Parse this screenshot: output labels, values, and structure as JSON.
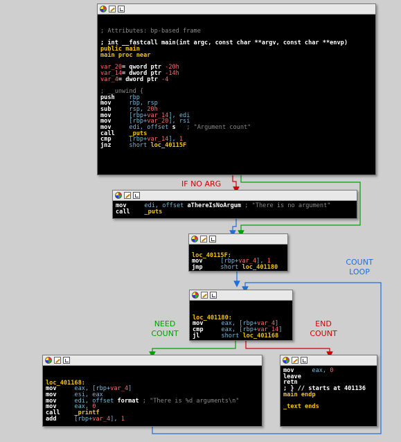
{
  "nodes": {
    "main": [
      {
        "segs": [
          {
            "t": "; Attributes: bp-based frame",
            "c": "c"
          }
        ]
      },
      {
        "segs": []
      },
      {
        "segs": [
          {
            "t": "; int __fastcall main(int argc, const char **argv, const char **envp)",
            "c": "k"
          }
        ]
      },
      {
        "segs": [
          {
            "t": "public main",
            "c": "lbl"
          }
        ]
      },
      {
        "segs": [
          {
            "t": "main proc near",
            "c": "lbl"
          }
        ]
      },
      {
        "segs": []
      },
      {
        "segs": [
          {
            "t": "var_20",
            "c": "num"
          },
          {
            "t": "= qword ptr ",
            "c": "k"
          },
          {
            "t": "-20h",
            "c": "num"
          }
        ]
      },
      {
        "segs": [
          {
            "t": "var_14",
            "c": "num"
          },
          {
            "t": "= dword ptr ",
            "c": "k"
          },
          {
            "t": "-14h",
            "c": "num"
          }
        ]
      },
      {
        "segs": [
          {
            "t": "var_4",
            "c": "num"
          },
          {
            "t": "= dword ptr ",
            "c": "k"
          },
          {
            "t": "-4",
            "c": "num"
          }
        ]
      },
      {
        "segs": []
      },
      {
        "segs": [
          {
            "t": "; __unwind {",
            "c": "c"
          }
        ]
      },
      {
        "segs": [
          {
            "t": "push    ",
            "c": "k"
          },
          {
            "t": "rbp",
            "c": "o"
          }
        ]
      },
      {
        "segs": [
          {
            "t": "mov     ",
            "c": "k"
          },
          {
            "t": "rbp, rsp",
            "c": "o"
          }
        ]
      },
      {
        "segs": [
          {
            "t": "sub     ",
            "c": "k"
          },
          {
            "t": "rsp, ",
            "c": "o"
          },
          {
            "t": "20h",
            "c": "num"
          }
        ]
      },
      {
        "segs": [
          {
            "t": "mov     ",
            "c": "k"
          },
          {
            "t": "[rbp+",
            "c": "o"
          },
          {
            "t": "var_14",
            "c": "num"
          },
          {
            "t": "], edi",
            "c": "o"
          }
        ]
      },
      {
        "segs": [
          {
            "t": "mov     ",
            "c": "k"
          },
          {
            "t": "[rbp+",
            "c": "o"
          },
          {
            "t": "var_20",
            "c": "num"
          },
          {
            "t": "], rsi",
            "c": "o"
          }
        ]
      },
      {
        "segs": [
          {
            "t": "mov     ",
            "c": "k"
          },
          {
            "t": "edi, offset ",
            "c": "o"
          },
          {
            "t": "s",
            "c": "k"
          },
          {
            "t": "   ; \"Argument count\"",
            "c": "c"
          }
        ]
      },
      {
        "segs": [
          {
            "t": "call    ",
            "c": "k"
          },
          {
            "t": "_puts",
            "c": "lbl"
          }
        ]
      },
      {
        "segs": [
          {
            "t": "cmp     ",
            "c": "k"
          },
          {
            "t": "[rbp+",
            "c": "o"
          },
          {
            "t": "var_14",
            "c": "num"
          },
          {
            "t": "], ",
            "c": "o"
          },
          {
            "t": "1",
            "c": "num"
          }
        ]
      },
      {
        "segs": [
          {
            "t": "jnz     ",
            "c": "k"
          },
          {
            "t": "short ",
            "c": "o"
          },
          {
            "t": "loc_40115F",
            "c": "lbl"
          }
        ]
      }
    ],
    "noarg": [
      {
        "segs": [
          {
            "t": "mov     ",
            "c": "k"
          },
          {
            "t": "edi, offset ",
            "c": "o"
          },
          {
            "t": "aThereIsNoArgum",
            "c": "k"
          },
          {
            "t": " ; \"There is no argument\"",
            "c": "c"
          }
        ]
      },
      {
        "segs": [
          {
            "t": "call    ",
            "c": "k"
          },
          {
            "t": "_puts",
            "c": "lbl"
          }
        ]
      }
    ],
    "loc115f": [
      {
        "segs": []
      },
      {
        "segs": [
          {
            "t": "loc_40115F:",
            "c": "lbl"
          }
        ]
      },
      {
        "segs": [
          {
            "t": "mov     ",
            "c": "k"
          },
          {
            "t": "[rbp+",
            "c": "o"
          },
          {
            "t": "var_4",
            "c": "num"
          },
          {
            "t": "], ",
            "c": "o"
          },
          {
            "t": "1",
            "c": "num"
          }
        ]
      },
      {
        "segs": [
          {
            "t": "jmp     ",
            "c": "k"
          },
          {
            "t": "short ",
            "c": "o"
          },
          {
            "t": "loc_401180",
            "c": "lbl"
          }
        ]
      }
    ],
    "loc1180": [
      {
        "segs": []
      },
      {
        "segs": [
          {
            "t": "loc_401180:",
            "c": "lbl"
          }
        ]
      },
      {
        "segs": [
          {
            "t": "mov     ",
            "c": "k"
          },
          {
            "t": "eax, [rbp+",
            "c": "o"
          },
          {
            "t": "var_4",
            "c": "num"
          },
          {
            "t": "]",
            "c": "o"
          }
        ]
      },
      {
        "segs": [
          {
            "t": "cmp     ",
            "c": "k"
          },
          {
            "t": "eax, [rbp+",
            "c": "o"
          },
          {
            "t": "var_14",
            "c": "num"
          },
          {
            "t": "]",
            "c": "o"
          }
        ]
      },
      {
        "segs": [
          {
            "t": "jl      ",
            "c": "k"
          },
          {
            "t": "short ",
            "c": "o"
          },
          {
            "t": "loc_401168",
            "c": "lbl"
          }
        ]
      }
    ],
    "loc1168": [
      {
        "segs": []
      },
      {
        "segs": [
          {
            "t": "loc_401168:",
            "c": "lbl"
          }
        ]
      },
      {
        "segs": [
          {
            "t": "mov     ",
            "c": "k"
          },
          {
            "t": "eax, [rbp+",
            "c": "o"
          },
          {
            "t": "var_4",
            "c": "num"
          },
          {
            "t": "]",
            "c": "o"
          }
        ]
      },
      {
        "segs": [
          {
            "t": "mov     ",
            "c": "k"
          },
          {
            "t": "esi, eax",
            "c": "o"
          }
        ]
      },
      {
        "segs": [
          {
            "t": "mov     ",
            "c": "k"
          },
          {
            "t": "edi, offset ",
            "c": "o"
          },
          {
            "t": "format",
            "c": "k"
          },
          {
            "t": " ; \"There is %d arguments\\n\"",
            "c": "c"
          }
        ]
      },
      {
        "segs": [
          {
            "t": "mov     ",
            "c": "k"
          },
          {
            "t": "eax, ",
            "c": "o"
          },
          {
            "t": "0",
            "c": "num"
          }
        ]
      },
      {
        "segs": [
          {
            "t": "call    ",
            "c": "k"
          },
          {
            "t": "_printf",
            "c": "lbl"
          }
        ]
      },
      {
        "segs": [
          {
            "t": "add     ",
            "c": "k"
          },
          {
            "t": "[rbp+",
            "c": "o"
          },
          {
            "t": "var_4",
            "c": "num"
          },
          {
            "t": "], ",
            "c": "o"
          },
          {
            "t": "1",
            "c": "num"
          }
        ]
      }
    ],
    "exit": [
      {
        "segs": [
          {
            "t": "mov     ",
            "c": "k"
          },
          {
            "t": "eax, ",
            "c": "o"
          },
          {
            "t": "0",
            "c": "num"
          }
        ]
      },
      {
        "segs": [
          {
            "t": "leave",
            "c": "k"
          }
        ]
      },
      {
        "segs": [
          {
            "t": "retn",
            "c": "k"
          }
        ]
      },
      {
        "segs": [
          {
            "t": "; } // starts at 401136",
            "c": "k"
          }
        ]
      },
      {
        "segs": [
          {
            "t": "main endp",
            "c": "lbl"
          }
        ]
      },
      {
        "segs": []
      },
      {
        "segs": [
          {
            "t": "_text ends",
            "c": "lbl"
          }
        ]
      }
    ]
  },
  "annotations": {
    "if_no_arg": "IF NO ARG",
    "count_loop_1": "COUNT",
    "count_loop_2": "LOOP",
    "need_count_1": "NEED",
    "need_count_2": "COUNT",
    "end_count_1": "END",
    "end_count_2": "COUNT"
  },
  "colors": {
    "edge_true": "#00a000",
    "edge_false": "#d00000",
    "edge_uncond": "#1e6fd9"
  },
  "header_icons": [
    "color-icon",
    "rename-icon",
    "graph-icon"
  ]
}
